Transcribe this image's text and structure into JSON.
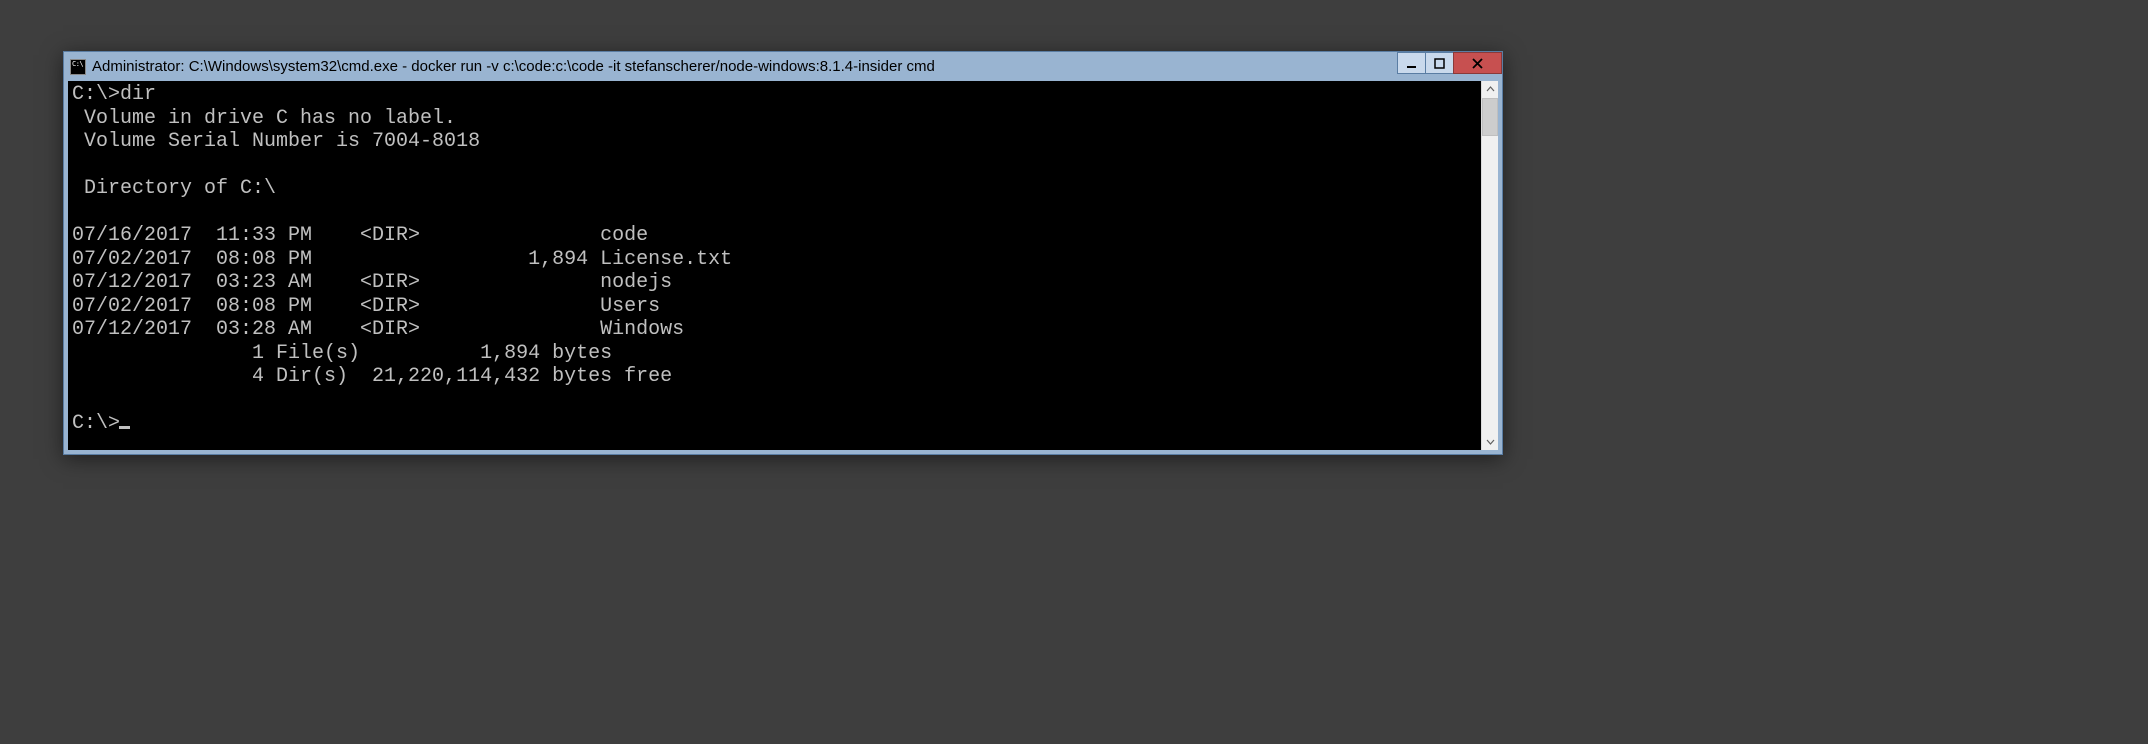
{
  "titlebar": {
    "icon_label": "C:\\",
    "title": "Administrator: C:\\Windows\\system32\\cmd.exe - docker  run -v c:\\code:c:\\code -it stefanscherer/node-windows:8.1.4-insider cmd"
  },
  "terminal": {
    "prompt1": "C:\\>",
    "command1": "dir",
    "vol_line": " Volume in drive C has no label.",
    "serial_line": " Volume Serial Number is 7004-8018",
    "dir_of_line": " Directory of C:\\",
    "entries": [
      {
        "date": "07/16/2017",
        "time": "11:33 PM",
        "type": "<DIR>",
        "size": "",
        "name": "code"
      },
      {
        "date": "07/02/2017",
        "time": "08:08 PM",
        "type": "",
        "size": "1,894",
        "name": "License.txt"
      },
      {
        "date": "07/12/2017",
        "time": "03:23 AM",
        "type": "<DIR>",
        "size": "",
        "name": "nodejs"
      },
      {
        "date": "07/02/2017",
        "time": "08:08 PM",
        "type": "<DIR>",
        "size": "",
        "name": "Users"
      },
      {
        "date": "07/12/2017",
        "time": "03:28 AM",
        "type": "<DIR>",
        "size": "",
        "name": "Windows"
      }
    ],
    "summary_files": "               1 File(s)          1,894 bytes",
    "summary_dirs": "               4 Dir(s)  21,220,114,432 bytes free",
    "prompt2": "C:\\>"
  }
}
